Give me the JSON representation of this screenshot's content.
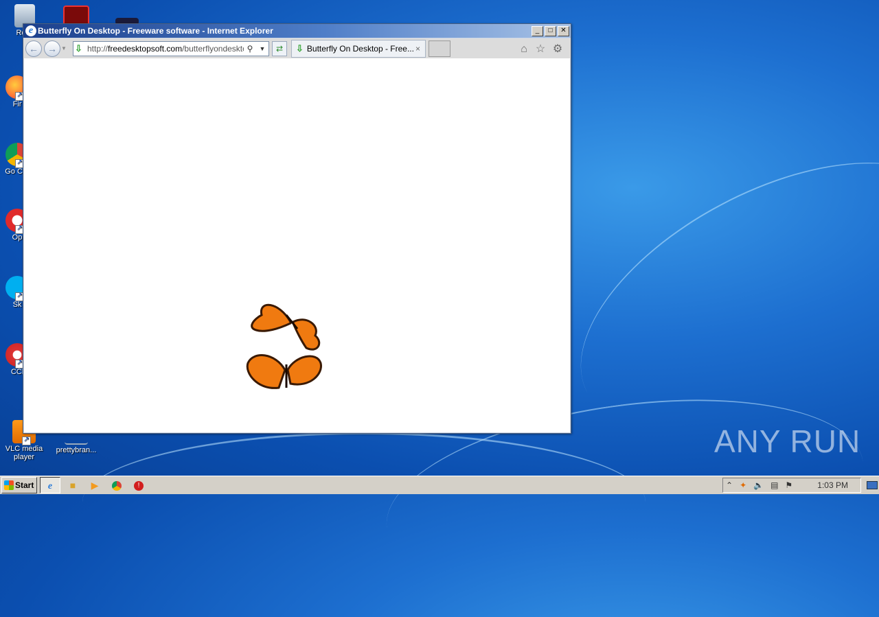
{
  "desktop": {
    "icons": [
      {
        "label": "Recy"
      },
      {
        "label": "Fir"
      },
      {
        "label": "Go Chr"
      },
      {
        "label": "Op"
      },
      {
        "label": "Sk"
      },
      {
        "label": "CCl"
      },
      {
        "label": "VLC media player"
      },
      {
        "label": "prettybran..."
      }
    ],
    "watermark": "ANY RUN"
  },
  "window": {
    "title": "Butterfly On Desktop - Freeware software - Internet Explorer",
    "controls": {
      "minimize": "_",
      "maximize": "□",
      "close": "✕"
    },
    "address": {
      "url_prefix": "http://",
      "url_domain": "freedesktopsoft.com",
      "url_path": "/butterflyondesktop"
    },
    "tab": {
      "title": "Butterfly On Desktop - Free...",
      "close": "×"
    }
  },
  "taskbar": {
    "start_label": "Start",
    "clock": "1:03 PM"
  },
  "colors": {
    "accent_butterfly": "#f07a10",
    "desktop_blue": "#1d6fd0"
  }
}
